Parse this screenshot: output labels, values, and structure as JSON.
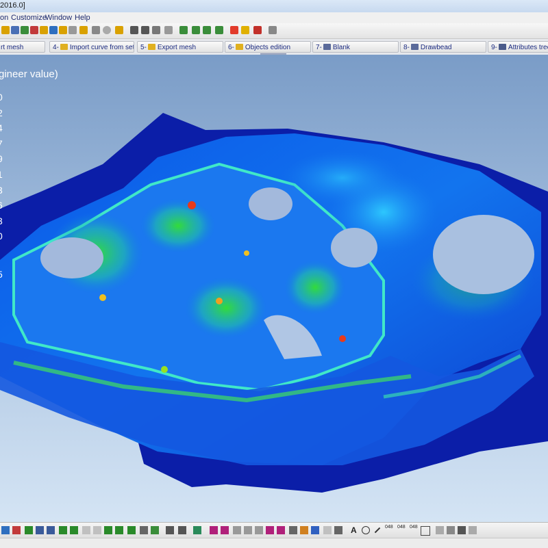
{
  "window": {
    "title_fragment": "2016.0]"
  },
  "menu": {
    "items": [
      "on",
      "Customize",
      "Window",
      "Help"
    ]
  },
  "steps": [
    {
      "label": "rt mesh"
    },
    {
      "num": "4-",
      "label": "Import curve from setup"
    },
    {
      "num": "5-",
      "label": "Export mesh"
    },
    {
      "num": "6-",
      "label": "Objects edition"
    },
    {
      "num": "7-",
      "label": "Blank"
    },
    {
      "num": "8-",
      "label": "Drawbead"
    },
    {
      "num": "9-",
      "label": "Attributes tree"
    }
  ],
  "legend": {
    "title": "gineer value)",
    "values": [
      "0",
      "2",
      "4",
      "7",
      "9",
      "1",
      "3",
      "6",
      "3",
      "0",
      "5"
    ]
  },
  "bottom_toolbar": {
    "labels": [
      "A",
      "048",
      "048",
      "048"
    ]
  },
  "colors": {
    "accent": "#1b2a80",
    "viewport_top": "#7a9cc7",
    "viewport_bottom": "#d4e4f4"
  }
}
